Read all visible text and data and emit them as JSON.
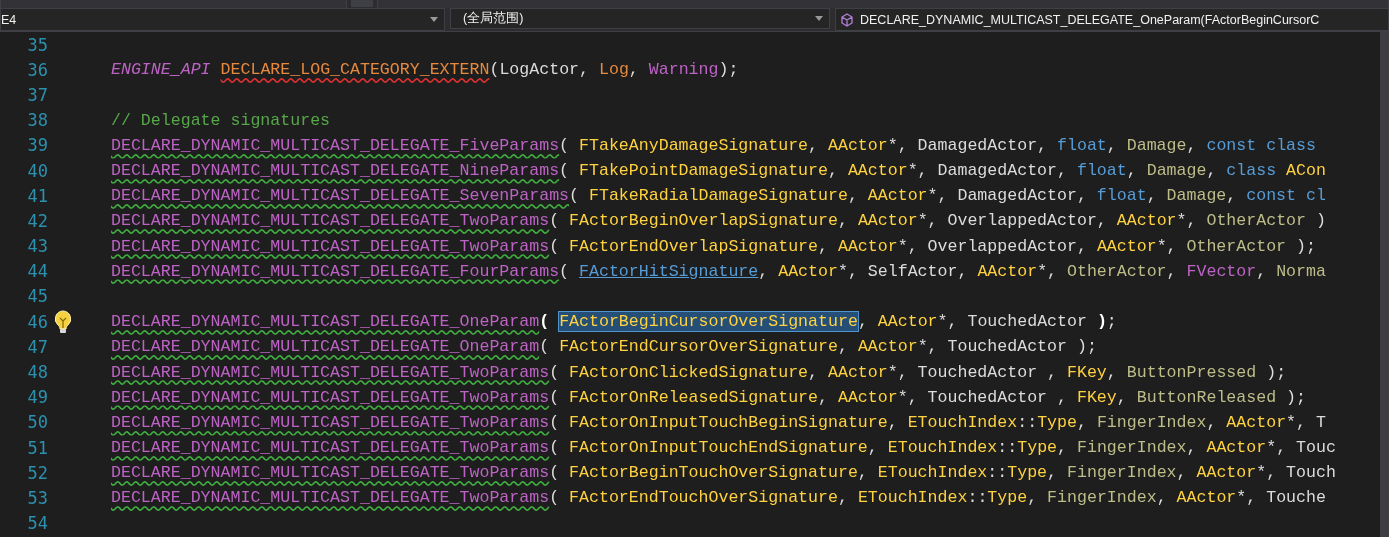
{
  "navigation_bar": {
    "project_dropdown": "E4",
    "scope_dropdown": "(全局范围)",
    "member_dropdown": "DECLARE_DYNAMIC_MULTICAST_DELEGATE_OneParam(FActorBeginCursorC"
  },
  "editor": {
    "lines": [
      {
        "number": "35"
      },
      {
        "number": "36",
        "tokens": [
          {
            "text": "ENGINE_API",
            "kind": "api"
          },
          {
            "text": "DECLARE_LOG_CATEGORY_EXTERN",
            "kind": "unresolved",
            "error_squiggle": true,
            "space_before": true
          },
          {
            "text": "(LogActor, ",
            "kind": "plain"
          },
          {
            "text": "Log",
            "kind": "unresolved"
          },
          {
            "text": ", ",
            "kind": "plain"
          },
          {
            "text": "Warning",
            "kind": "macro"
          },
          {
            "text": ");",
            "kind": "plain"
          }
        ]
      },
      {
        "number": "37"
      },
      {
        "number": "38",
        "tokens": [
          {
            "text": "// Delegate signatures",
            "kind": "comment"
          }
        ]
      },
      {
        "number": "39",
        "tokens": [
          {
            "text": "DECLARE_DYNAMIC_MULTICAST_DELEGATE_FiveParams",
            "kind": "macro",
            "warning_squiggle": true
          },
          {
            "text": "( ",
            "kind": "plain"
          },
          {
            "text": "FTakeAnyDamageSignature",
            "kind": "type"
          },
          {
            "text": ", ",
            "kind": "plain"
          },
          {
            "text": "AActor",
            "kind": "type"
          },
          {
            "text": "*, DamagedActor, ",
            "kind": "plain"
          },
          {
            "text": "float",
            "kind": "keyword"
          },
          {
            "text": ", ",
            "kind": "plain"
          },
          {
            "text": "Damage",
            "kind": "param"
          },
          {
            "text": ", ",
            "kind": "plain"
          },
          {
            "text": "const class",
            "kind": "keyword"
          }
        ]
      },
      {
        "number": "40",
        "tokens": [
          {
            "text": "DECLARE_DYNAMIC_MULTICAST_DELEGATE_NineParams",
            "kind": "macro",
            "warning_squiggle": true
          },
          {
            "text": "( ",
            "kind": "plain"
          },
          {
            "text": "FTakePointDamageSignature",
            "kind": "type"
          },
          {
            "text": ", ",
            "kind": "plain"
          },
          {
            "text": "AActor",
            "kind": "type"
          },
          {
            "text": "*, DamagedActor, ",
            "kind": "plain"
          },
          {
            "text": "float",
            "kind": "keyword"
          },
          {
            "text": ", ",
            "kind": "plain"
          },
          {
            "text": "Damage",
            "kind": "param"
          },
          {
            "text": ", ",
            "kind": "plain"
          },
          {
            "text": "class",
            "kind": "keyword"
          },
          {
            "text": "ACon",
            "kind": "type",
            "space_before": true
          }
        ]
      },
      {
        "number": "41",
        "tokens": [
          {
            "text": "DECLARE_DYNAMIC_MULTICAST_DELEGATE_SevenParams",
            "kind": "macro",
            "warning_squiggle": true
          },
          {
            "text": "( ",
            "kind": "plain"
          },
          {
            "text": "FTakeRadialDamageSignature",
            "kind": "type"
          },
          {
            "text": ", ",
            "kind": "plain"
          },
          {
            "text": "AActor",
            "kind": "type"
          },
          {
            "text": "*, DamagedActor, ",
            "kind": "plain"
          },
          {
            "text": "float",
            "kind": "keyword"
          },
          {
            "text": ", ",
            "kind": "plain"
          },
          {
            "text": "Damage",
            "kind": "param"
          },
          {
            "text": ", ",
            "kind": "plain"
          },
          {
            "text": "const cl",
            "kind": "keyword"
          }
        ]
      },
      {
        "number": "42",
        "tokens": [
          {
            "text": "DECLARE_DYNAMIC_MULTICAST_DELEGATE_TwoParams",
            "kind": "macro",
            "warning_squiggle": true
          },
          {
            "text": "( ",
            "kind": "plain"
          },
          {
            "text": "FActorBeginOverlapSignature",
            "kind": "type"
          },
          {
            "text": ", ",
            "kind": "plain"
          },
          {
            "text": "AActor",
            "kind": "type"
          },
          {
            "text": "*, OverlappedActor, ",
            "kind": "plain"
          },
          {
            "text": "AActor",
            "kind": "type"
          },
          {
            "text": "*, ",
            "kind": "plain"
          },
          {
            "text": "OtherActor",
            "kind": "param"
          },
          {
            "text": " )",
            "kind": "plain"
          }
        ]
      },
      {
        "number": "43",
        "tokens": [
          {
            "text": "DECLARE_DYNAMIC_MULTICAST_DELEGATE_TwoParams",
            "kind": "macro",
            "warning_squiggle": true
          },
          {
            "text": "( ",
            "kind": "plain"
          },
          {
            "text": "FActorEndOverlapSignature",
            "kind": "type"
          },
          {
            "text": ", ",
            "kind": "plain"
          },
          {
            "text": "AActor",
            "kind": "type"
          },
          {
            "text": "*, OverlappedActor, ",
            "kind": "plain"
          },
          {
            "text": "AActor",
            "kind": "type"
          },
          {
            "text": "*, ",
            "kind": "plain"
          },
          {
            "text": "OtherActor",
            "kind": "param"
          },
          {
            "text": " );",
            "kind": "plain"
          }
        ]
      },
      {
        "number": "44",
        "tokens": [
          {
            "text": "DECLARE_DYNAMIC_MULTICAST_DELEGATE_FourParams",
            "kind": "macro",
            "warning_squiggle": true
          },
          {
            "text": "( ",
            "kind": "plain"
          },
          {
            "text": "FActorHitSignature",
            "kind": "link"
          },
          {
            "text": ", ",
            "kind": "plain"
          },
          {
            "text": "AActor",
            "kind": "type"
          },
          {
            "text": "*, SelfActor, ",
            "kind": "plain"
          },
          {
            "text": "AActor",
            "kind": "type"
          },
          {
            "text": "*, ",
            "kind": "plain"
          },
          {
            "text": "OtherActor",
            "kind": "param"
          },
          {
            "text": ", ",
            "kind": "plain"
          },
          {
            "text": "FVector",
            "kind": "macro"
          },
          {
            "text": ", ",
            "kind": "plain"
          },
          {
            "text": "Norma",
            "kind": "param"
          }
        ]
      },
      {
        "number": "45"
      },
      {
        "number": "46",
        "hint": true,
        "tokens": [
          {
            "text": "DECLARE_DYNAMIC_MULTICAST_DELEGATE_OneParam",
            "kind": "macro",
            "warning_squiggle": true
          },
          {
            "text": "(",
            "kind": "brace"
          },
          {
            "text": "FActorBeginCursorOverSignature",
            "kind": "type",
            "selected": true,
            "space_before": true
          },
          {
            "text": ", ",
            "kind": "plain"
          },
          {
            "text": "AActor",
            "kind": "type"
          },
          {
            "text": "*, TouchedActor ",
            "kind": "plain"
          },
          {
            "text": ")",
            "kind": "brace"
          },
          {
            "text": ";",
            "kind": "plain"
          }
        ]
      },
      {
        "number": "47",
        "tokens": [
          {
            "text": "DECLARE_DYNAMIC_MULTICAST_DELEGATE_OneParam",
            "kind": "macro",
            "warning_squiggle": true
          },
          {
            "text": "( ",
            "kind": "plain"
          },
          {
            "text": "FActorEndCursorOverSignature",
            "kind": "type"
          },
          {
            "text": ", ",
            "kind": "plain"
          },
          {
            "text": "AActor",
            "kind": "type"
          },
          {
            "text": "*, TouchedActor );",
            "kind": "plain"
          }
        ]
      },
      {
        "number": "48",
        "tokens": [
          {
            "text": "DECLARE_DYNAMIC_MULTICAST_DELEGATE_TwoParams",
            "kind": "macro",
            "warning_squiggle": true
          },
          {
            "text": "( ",
            "kind": "plain"
          },
          {
            "text": "FActorOnClickedSignature",
            "kind": "type"
          },
          {
            "text": ", ",
            "kind": "plain"
          },
          {
            "text": "AActor",
            "kind": "type"
          },
          {
            "text": "*, TouchedActor , ",
            "kind": "plain"
          },
          {
            "text": "FKey",
            "kind": "type"
          },
          {
            "text": ", ",
            "kind": "plain"
          },
          {
            "text": "ButtonPressed",
            "kind": "param"
          },
          {
            "text": " );",
            "kind": "plain"
          }
        ]
      },
      {
        "number": "49",
        "tokens": [
          {
            "text": "DECLARE_DYNAMIC_MULTICAST_DELEGATE_TwoParams",
            "kind": "macro",
            "warning_squiggle": true
          },
          {
            "text": "( ",
            "kind": "plain"
          },
          {
            "text": "FActorOnReleasedSignature",
            "kind": "type"
          },
          {
            "text": ", ",
            "kind": "plain"
          },
          {
            "text": "AActor",
            "kind": "type"
          },
          {
            "text": "*, TouchedActor , ",
            "kind": "plain"
          },
          {
            "text": "FKey",
            "kind": "type"
          },
          {
            "text": ", ",
            "kind": "plain"
          },
          {
            "text": "ButtonReleased",
            "kind": "param"
          },
          {
            "text": " );",
            "kind": "plain"
          }
        ]
      },
      {
        "number": "50",
        "tokens": [
          {
            "text": "DECLARE_DYNAMIC_MULTICAST_DELEGATE_TwoParams",
            "kind": "macro",
            "warning_squiggle": true
          },
          {
            "text": "( ",
            "kind": "plain"
          },
          {
            "text": "FActorOnInputTouchBeginSignature",
            "kind": "type"
          },
          {
            "text": ", ",
            "kind": "plain"
          },
          {
            "text": "ETouchIndex",
            "kind": "type"
          },
          {
            "text": "::",
            "kind": "plain"
          },
          {
            "text": "Type",
            "kind": "type"
          },
          {
            "text": ", ",
            "kind": "plain"
          },
          {
            "text": "FingerIndex",
            "kind": "param"
          },
          {
            "text": ", ",
            "kind": "plain"
          },
          {
            "text": "AActor",
            "kind": "type"
          },
          {
            "text": "*, T",
            "kind": "plain"
          }
        ]
      },
      {
        "number": "51",
        "tokens": [
          {
            "text": "DECLARE_DYNAMIC_MULTICAST_DELEGATE_TwoParams",
            "kind": "macro",
            "warning_squiggle": true
          },
          {
            "text": "( ",
            "kind": "plain"
          },
          {
            "text": "FActorOnInputTouchEndSignature",
            "kind": "type"
          },
          {
            "text": ", ",
            "kind": "plain"
          },
          {
            "text": "ETouchIndex",
            "kind": "type"
          },
          {
            "text": "::",
            "kind": "plain"
          },
          {
            "text": "Type",
            "kind": "type"
          },
          {
            "text": ", ",
            "kind": "plain"
          },
          {
            "text": "FingerIndex",
            "kind": "param"
          },
          {
            "text": ", ",
            "kind": "plain"
          },
          {
            "text": "AActor",
            "kind": "type"
          },
          {
            "text": "*, Touc",
            "kind": "plain"
          }
        ]
      },
      {
        "number": "52",
        "tokens": [
          {
            "text": "DECLARE_DYNAMIC_MULTICAST_DELEGATE_TwoParams",
            "kind": "macro",
            "warning_squiggle": true
          },
          {
            "text": "( ",
            "kind": "plain"
          },
          {
            "text": "FActorBeginTouchOverSignature",
            "kind": "type"
          },
          {
            "text": ", ",
            "kind": "plain"
          },
          {
            "text": "ETouchIndex",
            "kind": "type"
          },
          {
            "text": "::",
            "kind": "plain"
          },
          {
            "text": "Type",
            "kind": "type"
          },
          {
            "text": ", ",
            "kind": "plain"
          },
          {
            "text": "FingerIndex",
            "kind": "param"
          },
          {
            "text": ", ",
            "kind": "plain"
          },
          {
            "text": "AActor",
            "kind": "type"
          },
          {
            "text": "*, Touch",
            "kind": "plain"
          }
        ]
      },
      {
        "number": "53",
        "tokens": [
          {
            "text": "DECLARE_DYNAMIC_MULTICAST_DELEGATE_TwoParams",
            "kind": "macro",
            "warning_squiggle": true
          },
          {
            "text": "( ",
            "kind": "plain"
          },
          {
            "text": "FActorEndTouchOverSignature",
            "kind": "type"
          },
          {
            "text": ", ",
            "kind": "plain"
          },
          {
            "text": "ETouchIndex",
            "kind": "type"
          },
          {
            "text": "::",
            "kind": "plain"
          },
          {
            "text": "Type",
            "kind": "type"
          },
          {
            "text": ", ",
            "kind": "plain"
          },
          {
            "text": "FingerIndex",
            "kind": "param"
          },
          {
            "text": ", ",
            "kind": "plain"
          },
          {
            "text": "AActor",
            "kind": "type"
          },
          {
            "text": "*, Touche",
            "kind": "plain"
          }
        ]
      },
      {
        "number": "54"
      }
    ]
  }
}
